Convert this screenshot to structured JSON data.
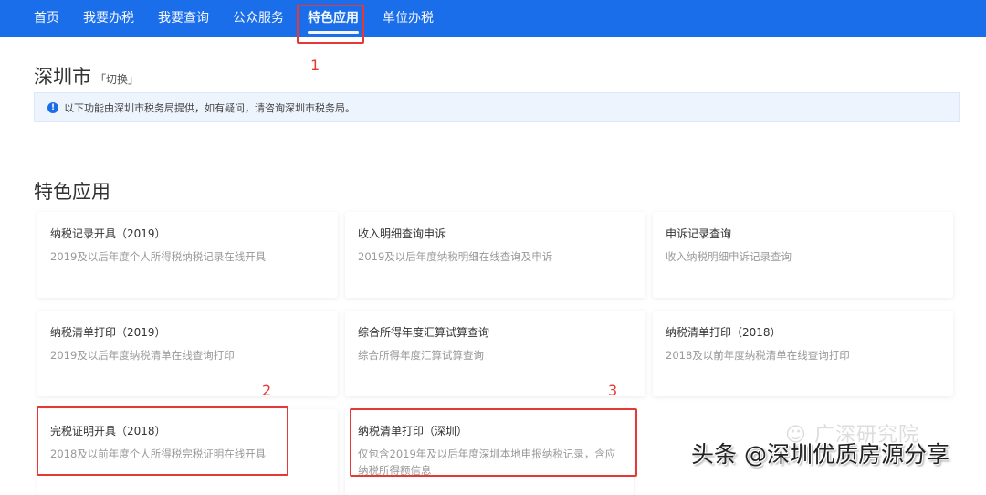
{
  "nav": {
    "items": [
      {
        "label": "首页"
      },
      {
        "label": "我要办税"
      },
      {
        "label": "我要查询"
      },
      {
        "label": "公众服务"
      },
      {
        "label": "特色应用",
        "active": true
      },
      {
        "label": "单位办税"
      }
    ]
  },
  "city": {
    "name": "深圳市",
    "switch_label": "「切换」"
  },
  "notice": {
    "icon": "info-icon",
    "text": "以下功能由深圳市税务局提供，如有疑问，请咨询深圳市税务局。"
  },
  "section_title": "特色应用",
  "cards": [
    {
      "title": "纳税记录开具（2019）",
      "desc": "2019及以后年度个人所得税纳税记录在线开具"
    },
    {
      "title": "收入明细查询申诉",
      "desc": "2019及以后年度纳税明细在线查询及申诉"
    },
    {
      "title": "申诉记录查询",
      "desc": "收入纳税明细申诉记录查询"
    },
    {
      "title": "纳税清单打印（2019）",
      "desc": "2019及以后年度纳税清单在线查询打印"
    },
    {
      "title": "综合所得年度汇算试算查询",
      "desc": "综合所得年度汇算试算查询"
    },
    {
      "title": "纳税清单打印（2018）",
      "desc": "2018及以前年度纳税清单在线查询打印"
    },
    {
      "title": "完税证明开具（2018）",
      "desc": "2018及以前年度个人所得税完税证明在线开具"
    },
    {
      "title": "纳税清单打印（深圳）",
      "desc": "仅包含2019年及以后年度深圳本地申报纳税记录，含应纳税所得额信息"
    }
  ],
  "annotations": [
    "1",
    "2",
    "3"
  ],
  "annotation_color": "#e53935",
  "watermarks": {
    "wechat": "广深研究院",
    "toutiao": "头条 @深圳优质房源分享"
  }
}
